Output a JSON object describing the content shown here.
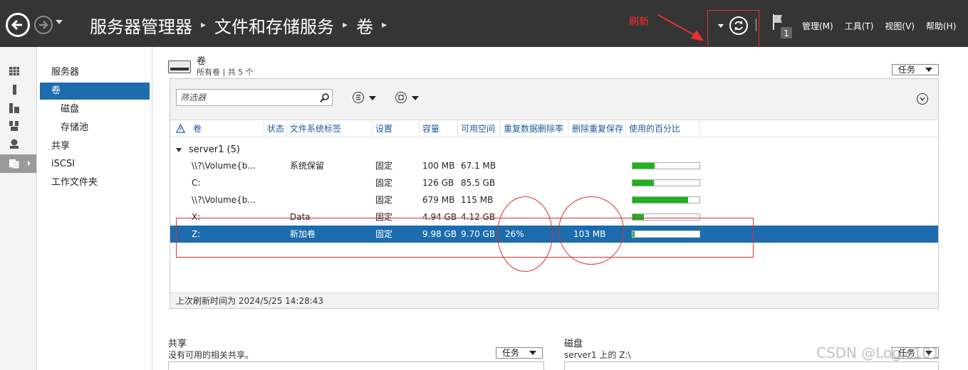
{
  "topbar": {
    "breadcrumb": [
      "服务器管理器",
      "文件和存储服务",
      "卷"
    ],
    "annotation_label": "刷新",
    "notification_count": "1",
    "menus": [
      "管理(M)",
      "工具(T)",
      "视图(V)",
      "帮助(H)"
    ]
  },
  "sidebar": {
    "items": [
      {
        "label": "服务器"
      },
      {
        "label": "卷"
      },
      {
        "label": "磁盘"
      },
      {
        "label": "存储池"
      },
      {
        "label": "共享"
      },
      {
        "label": "iSCSI"
      },
      {
        "label": "工作文件夹"
      }
    ]
  },
  "volumes": {
    "title": "卷",
    "subtitle": "所有卷 | 共 5 个",
    "tasks_label": "任务",
    "filter_placeholder": "筛选器",
    "columns": [
      "卷",
      "状态",
      "文件系统标签",
      "设置",
      "容量",
      "可用空间",
      "重复数据删除率",
      "删除重复保存",
      "使用的百分比"
    ],
    "group": "server1 (5)",
    "rows": [
      {
        "volume": "\\\\?\\Volume{b...",
        "status": "",
        "label": "系统保留",
        "setting": "固定",
        "capacity": "100 MB",
        "free": "67.1 MB",
        "dedup_rate": "",
        "dedup_saved": "",
        "used_pct": 33
      },
      {
        "volume": "C:",
        "status": "",
        "label": "",
        "setting": "固定",
        "capacity": "126 GB",
        "free": "85.5 GB",
        "dedup_rate": "",
        "dedup_saved": "",
        "used_pct": 32
      },
      {
        "volume": "\\\\?\\Volume{b...",
        "status": "",
        "label": "",
        "setting": "固定",
        "capacity": "679 MB",
        "free": "115 MB",
        "dedup_rate": "",
        "dedup_saved": "",
        "used_pct": 83
      },
      {
        "volume": "X:",
        "status": "",
        "label": "Data",
        "setting": "固定",
        "capacity": "4.94 GB",
        "free": "4.12 GB",
        "dedup_rate": "",
        "dedup_saved": "",
        "used_pct": 17
      },
      {
        "volume": "Z:",
        "status": "",
        "label": "新加卷",
        "setting": "固定",
        "capacity": "9.98 GB",
        "free": "9.70 GB",
        "dedup_rate": "26%",
        "dedup_saved": "103 MB",
        "used_pct": 3
      }
    ],
    "last_refresh": "上次刷新时间为 2024/5/25 14:28:43"
  },
  "shares": {
    "title": "共享",
    "subtitle": "没有可用的相关共享。",
    "tasks_label": "任务"
  },
  "disk": {
    "title": "磁盘",
    "subtitle": "server1 上的 Z:\\",
    "tasks_label": "任务"
  },
  "watermark": "CSDN @Logic101",
  "colors": {
    "topbar_bg": "#353535",
    "selection": "#1c6cae",
    "usage_fill": "#1db31d",
    "annotation": "#e03030"
  }
}
